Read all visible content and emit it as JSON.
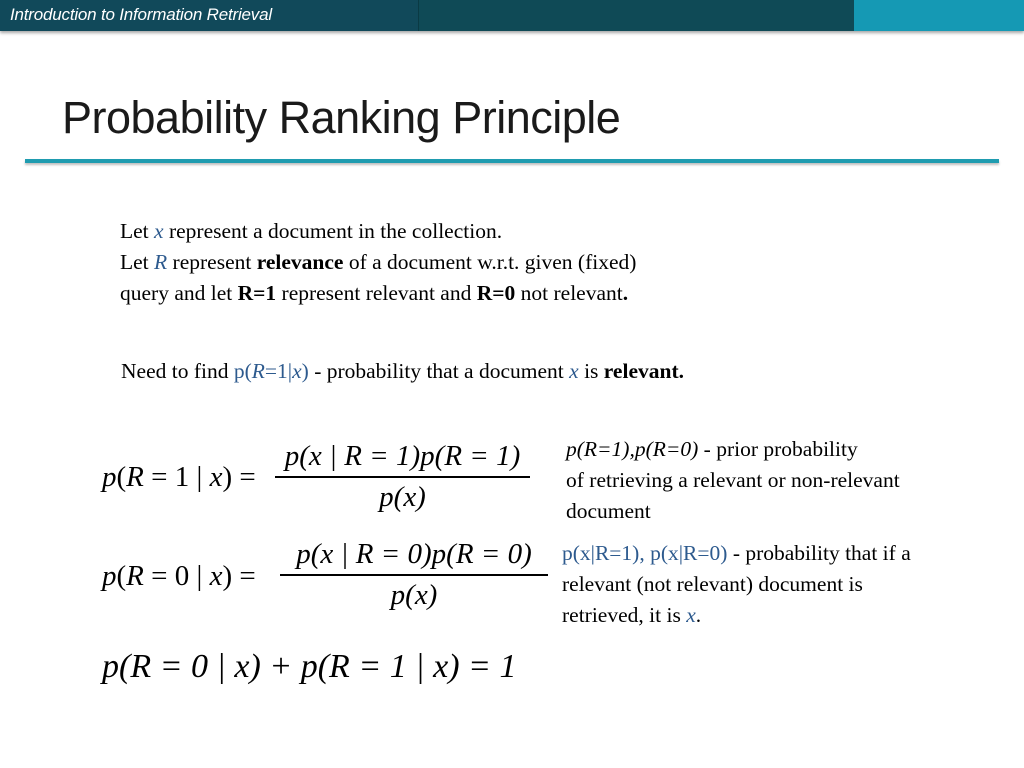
{
  "header": {
    "course_title": "Introduction to Information Retrieval",
    "colors": {
      "bar_dark": "#0f4a56",
      "bar_light": "#1599b4",
      "rule": "#1f9cb0",
      "accent_text": "#2d5a8e"
    }
  },
  "slide": {
    "title": "Probability Ranking Principle",
    "intro": {
      "line1": {
        "a": "Let ",
        "x": "x",
        "b": " represent a document in the collection."
      },
      "line2": {
        "a": "Let ",
        "R": "R",
        "b": " represent ",
        "bold": "relevance",
        "c": " of a document w.r.t. given (fixed)"
      },
      "line3": {
        "a": "query and let ",
        "b1": "R=1",
        "b": " represent relevant and ",
        "b2": "R=0",
        "c": " not relevant",
        "dot": "."
      }
    },
    "need": {
      "a": "Need to find ",
      "expr_p": "p(",
      "expr_R": "R",
      "expr_rest": "=1|",
      "expr_x": "x",
      "expr_close": ")",
      "b": " - probability that a document ",
      "x": "x",
      "c": " is ",
      "bold": "relevant."
    },
    "equations": {
      "eq1": {
        "lhs_p": "p",
        "lhs_open": "(",
        "lhs_R": "R",
        "lhs_mid": " = 1 | ",
        "lhs_x": "x",
        "lhs_close": ") = ",
        "num": "p(x | R = 1)p(R = 1)",
        "den": "p(x)"
      },
      "eq2": {
        "lhs_p": "p",
        "lhs_open": "(",
        "lhs_R": "R",
        "lhs_mid": " = 0 | ",
        "lhs_x": "x",
        "lhs_close": ") = ",
        "num": "p(x | R = 0)p(R = 0)",
        "den": "p(x)"
      },
      "eq3": "p(R = 0 | x) + p(R = 1 | x) = 1"
    },
    "notes": {
      "prior": {
        "expr": "p(R=1),p(R=0)",
        "text": " - prior probability",
        "line2": "of retrieving a relevant or non-relevant",
        "line3": "document"
      },
      "likelihood": {
        "expr": "p(x|R=1), p(x|R=0)",
        "text": " - probability that if a",
        "line2": "relevant (not relevant) document is",
        "line3a": "retrieved, it is ",
        "x": "x",
        "dot": "."
      }
    }
  }
}
